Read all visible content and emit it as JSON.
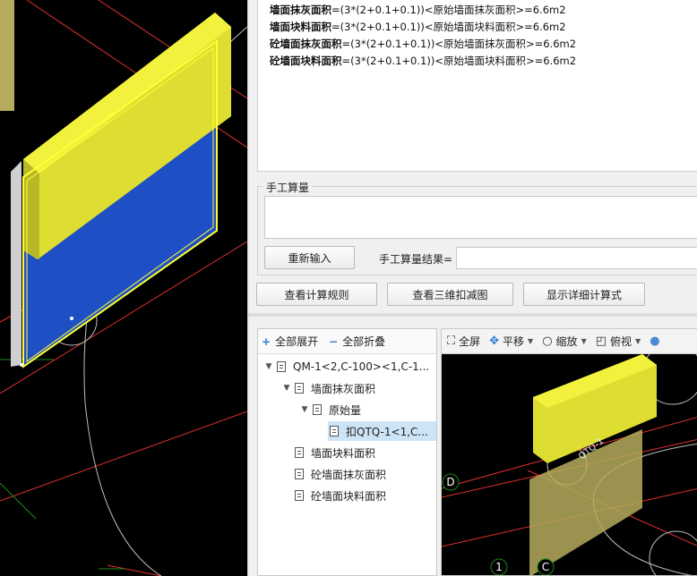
{
  "formula": {
    "lines": [
      {
        "label": "墙面抹灰面积",
        "expr": "=(3*(2+0.1+0.1))<原始墙面抹灰面积>=6.6m2"
      },
      {
        "label": "墙面块料面积",
        "expr": "=(3*(2+0.1+0.1))<原始墙面块料面积>=6.6m2"
      },
      {
        "label": "砼墙面抹灰面积",
        "expr": "=(3*(2+0.1+0.1))<原始墙面抹灰面积>=6.6m2"
      },
      {
        "label": "砼墙面块料面积",
        "expr": "=(3*(2+0.1+0.1))<原始墙面块料面积>=6.6m2"
      }
    ]
  },
  "manual": {
    "title": "手工算量",
    "reinput_label": "重新输入",
    "result_label": "手工算量结果=",
    "input_value": "",
    "result_value": ""
  },
  "buttons": {
    "rules": "查看计算规则",
    "deduct": "查看三维扣减图",
    "detail": "显示详细计算式"
  },
  "tree": {
    "expand_all": "全部展开",
    "collapse_all": "全部折叠",
    "items": [
      {
        "label": "QM-1<2,C-100><1,C-1...",
        "expander": "▼"
      },
      {
        "label": "墙面抹灰面积",
        "expander": "▼"
      },
      {
        "label": "原始量",
        "expander": "▼"
      },
      {
        "label": "扣QTQ-1<1,C...",
        "expander": ""
      },
      {
        "label": "墙面块料面积",
        "expander": ""
      },
      {
        "label": "砼墙面抹灰面积",
        "expander": ""
      },
      {
        "label": "砼墙面块料面积",
        "expander": ""
      }
    ]
  },
  "viewer": {
    "fullscreen": "全屏",
    "pan": "平移",
    "zoom": "缩放",
    "top_view": "俯视",
    "axis_labels": {
      "d": "D",
      "one": "1",
      "c": "C"
    },
    "element_label": "QTQ-1"
  },
  "colors": {
    "wall_yellow": "#e6e63a",
    "wall_blue": "#1f4fc4",
    "grid_red": "#e03030",
    "highlight_yellow": "#ffff33",
    "axis_green": "#1a8a1a"
  }
}
